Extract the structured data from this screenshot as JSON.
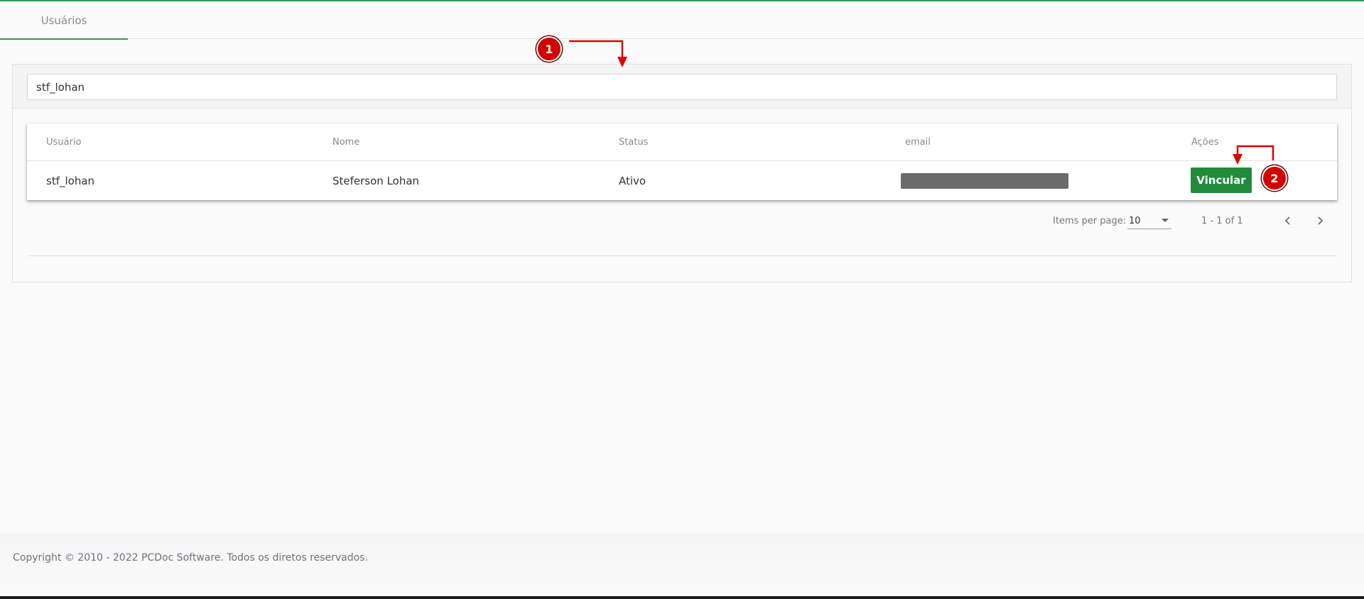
{
  "tabs": [
    {
      "label": "Usuários",
      "active": true
    }
  ],
  "search": {
    "value": "stf_lohan"
  },
  "table": {
    "columns": [
      "Usuário",
      "Nome",
      "Status",
      "email",
      "Ações"
    ],
    "rows": [
      {
        "usuario": "stf_lohan",
        "nome": "Steferson Lohan",
        "status": "Ativo",
        "action_label": "Vincular"
      }
    ]
  },
  "paginator": {
    "items_per_page_label": "Items per page:",
    "items_per_page_value": "10",
    "range_label": "1 - 1 of 1"
  },
  "annotations": {
    "step1": "1",
    "step2": "2"
  },
  "footer": {
    "copyright": "Copyright © 2010 - 2022 PCDoc Software. Todos os diretos reservados."
  },
  "colors": {
    "accent": "#2e9a5a",
    "button": "#228b3b",
    "annotation": "#d40000"
  }
}
